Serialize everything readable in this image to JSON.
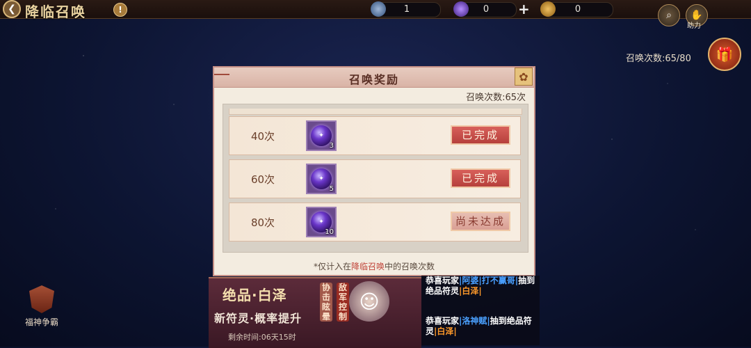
{
  "top": {
    "back_icon": "back-arrow-icon",
    "title": "降临召唤",
    "help_icon": "exclamation-icon",
    "resource_1": "1",
    "resource_2": "0",
    "resource_3": "0",
    "plus_icon": "+",
    "assist_label": "助力"
  },
  "side": {
    "summon_count": "召唤次数:65/80"
  },
  "modal": {
    "title": "召唤奖励",
    "count_label": "召唤次数:65次",
    "rows": [
      {
        "label": "40次",
        "qty": "3",
        "status": "已完成",
        "done": true
      },
      {
        "label": "60次",
        "qty": "5",
        "status": "已完成",
        "done": true
      },
      {
        "label": "80次",
        "qty": "10",
        "status": "尚未达成",
        "done": false
      }
    ],
    "footnote_pre": "*仅计入在",
    "footnote_hl": "降临召唤",
    "footnote_post": "中的召唤次数"
  },
  "banner": {
    "title": "绝品·白泽",
    "subtitle": "新符灵·概率提升",
    "time": "剩余时间:06天15时",
    "tag_a": "协击眩晕",
    "tag_b": "敌军控制"
  },
  "broadcast": {
    "msg1_pre": "恭喜玩家",
    "msg1_name": "|阿婆|打不赢哥|",
    "msg1_mid": "抽到绝品符灵",
    "msg1_item": "|白泽|",
    "msg2_pre": "恭喜玩家",
    "msg2_name": "|洛神赋|",
    "msg2_mid": "抽到绝品符灵",
    "msg2_item": "|白泽|"
  },
  "bottom_left": {
    "label": "福神争霸"
  },
  "colors": {
    "done_button": "#c0463f",
    "pending_button": "#e0aea3",
    "highlight": "#c0453a"
  }
}
